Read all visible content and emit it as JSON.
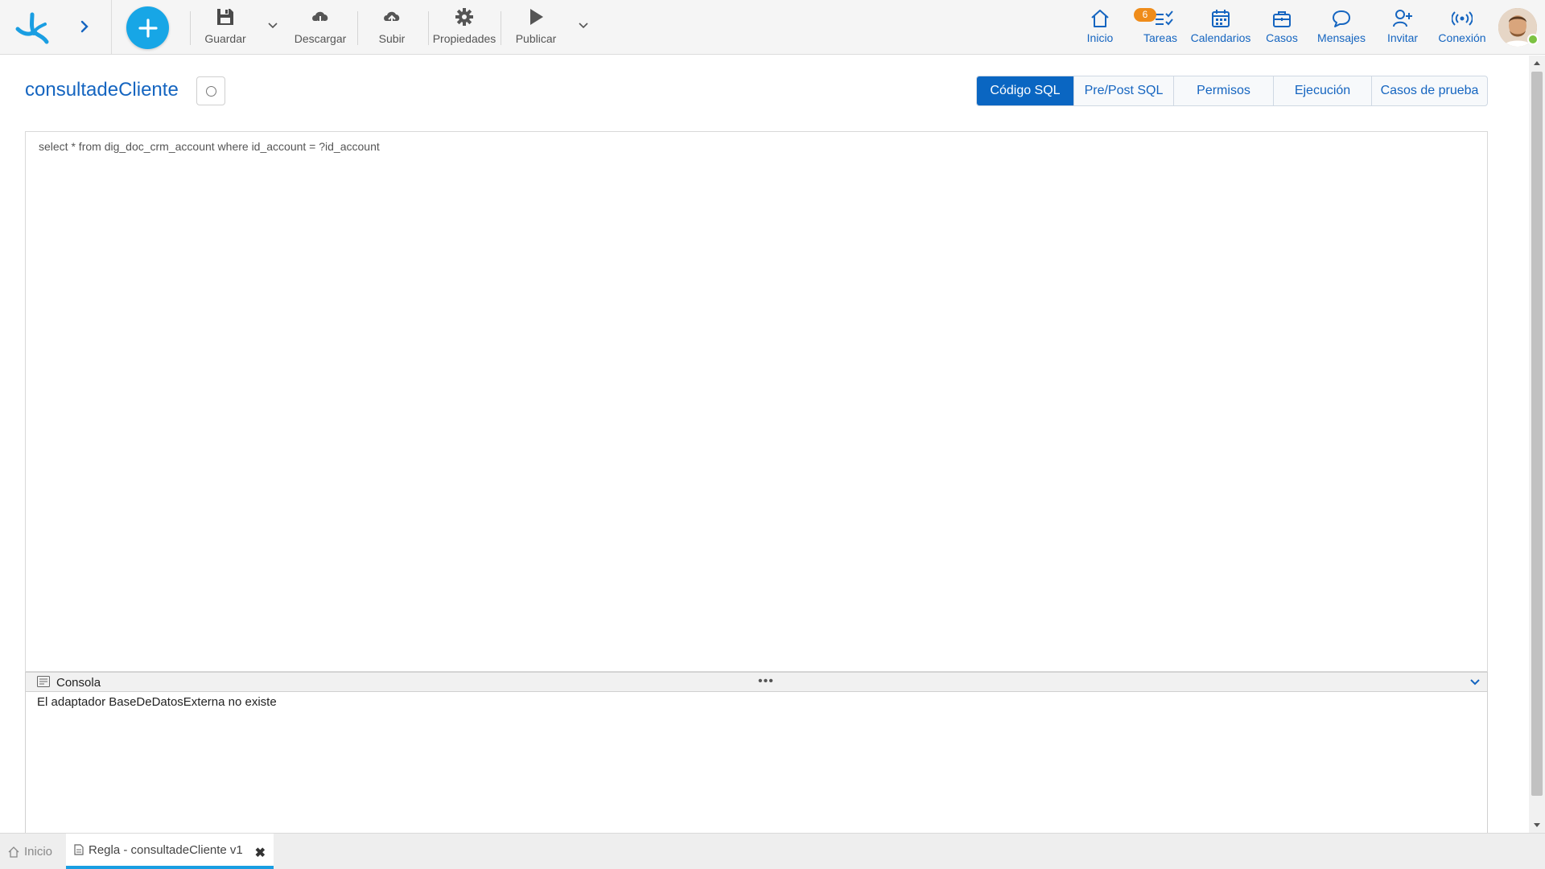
{
  "toolbar": {
    "save_label": "Guardar",
    "download_label": "Descargar",
    "upload_label": "Subir",
    "properties_label": "Propiedades",
    "publish_label": "Publicar"
  },
  "nav": {
    "home_label": "Inicio",
    "tasks_label": "Tareas",
    "tasks_badge": "6",
    "calendars_label": "Calendarios",
    "cases_label": "Casos",
    "messages_label": "Mensajes",
    "invite_label": "Invitar",
    "connection_label": "Conexión"
  },
  "header": {
    "title": "consultadeCliente"
  },
  "tabs": [
    {
      "label": "Código SQL",
      "active": true
    },
    {
      "label": "Pre/Post SQL",
      "active": false
    },
    {
      "label": "Permisos",
      "active": false
    },
    {
      "label": "Ejecución",
      "active": false
    },
    {
      "label": "Casos de prueba",
      "active": false
    }
  ],
  "editor": {
    "code": "select * from dig_doc_crm_account where id_account = ?id_account"
  },
  "console": {
    "title": "Consola",
    "grip": "•••",
    "message": "El adaptador BaseDeDatosExterna no existe"
  },
  "bottom_tabs": {
    "home_label": "Inicio",
    "rule_label": "Regla - consultadeCliente v1",
    "close_glyph": "✖"
  },
  "colors": {
    "accent": "#0a66c2",
    "link": "#1565c0",
    "add_button": "#17a6e6",
    "badge": "#ef8c1a",
    "online": "#7cc242"
  }
}
